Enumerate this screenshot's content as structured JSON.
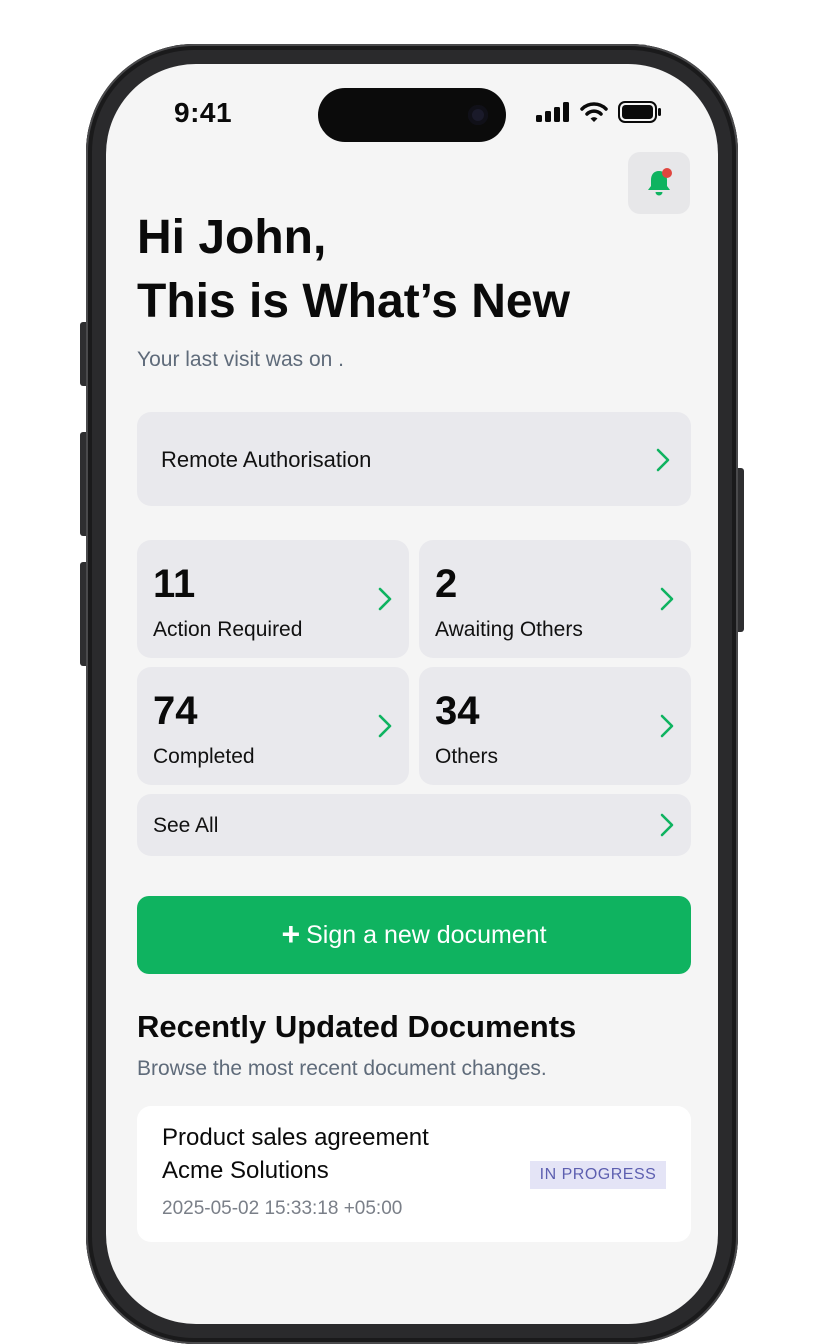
{
  "status_bar": {
    "time": "9:41"
  },
  "header": {
    "greeting_line1": "Hi John,",
    "greeting_line2": "This is What’s New",
    "last_visit": "Your last visit was on ."
  },
  "remote_authorisation": {
    "label": "Remote Authorisation"
  },
  "stats": [
    {
      "count": "11",
      "label": "Action Required"
    },
    {
      "count": "2",
      "label": "Awaiting Others"
    },
    {
      "count": "74",
      "label": "Completed"
    },
    {
      "count": "34",
      "label": "Others"
    }
  ],
  "see_all": {
    "label": "See All"
  },
  "sign_button": {
    "plus": "+",
    "label": "Sign a new document"
  },
  "recent": {
    "title": "Recently Updated Documents",
    "subtitle": "Browse the most recent document changes.",
    "documents": [
      {
        "name": "Product sales agreement",
        "company": "Acme Solutions",
        "date": "2025-05-02 15:33:18 +05:00",
        "status": "IN PROGRESS"
      }
    ]
  },
  "colors": {
    "accent": "#0fb360",
    "badge_bg": "#e4e4f6",
    "badge_text": "#5d5fb0",
    "notification_dot": "#e0463f"
  },
  "icons": {
    "notification": "bell-icon",
    "chevron": "chevron-right-icon",
    "signal": "cellular-signal-icon",
    "wifi": "wifi-icon",
    "battery": "battery-icon"
  }
}
